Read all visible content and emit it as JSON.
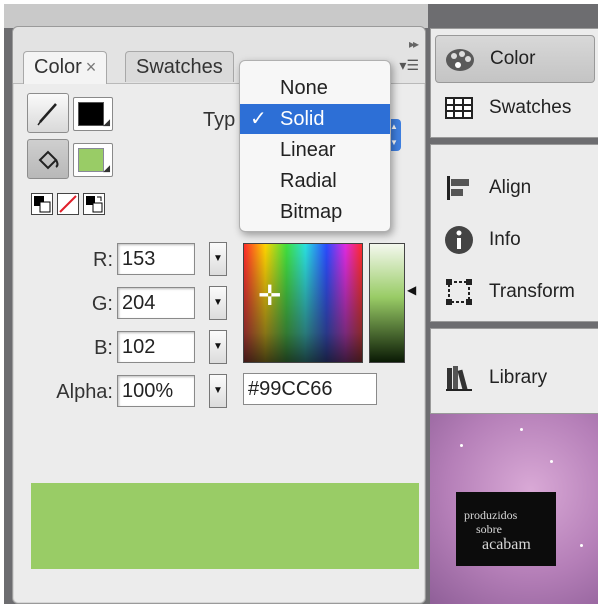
{
  "tabs": [
    {
      "label": "Color",
      "close": "×",
      "active": true
    },
    {
      "label": "Swatches",
      "active": false
    }
  ],
  "type_label": "Typ",
  "fill_types": {
    "options": [
      "None",
      "Solid",
      "Linear",
      "Radial",
      "Bitmap"
    ],
    "selected": "Solid",
    "check": "✓"
  },
  "channels": [
    {
      "label": "R:",
      "value": "153"
    },
    {
      "label": "G:",
      "value": "204"
    },
    {
      "label": "B:",
      "value": "102"
    },
    {
      "label": "Alpha:",
      "value": "100%"
    }
  ],
  "hex": "#99CC66",
  "colors": {
    "fill": "#99cc66",
    "stroke": "#000000",
    "accent": "#2d6fd6"
  },
  "dock": {
    "groups": [
      {
        "items": [
          {
            "label": "Color",
            "icon": "palette-icon",
            "active": true
          },
          {
            "label": "Swatches",
            "icon": "swatches-grid-icon",
            "active": false
          }
        ]
      },
      {
        "items": [
          {
            "label": "Align",
            "icon": "align-icon",
            "active": false
          },
          {
            "label": "Info",
            "icon": "info-icon",
            "active": false
          },
          {
            "label": "Transform",
            "icon": "transform-icon",
            "active": false
          }
        ]
      },
      {
        "items": [
          {
            "label": "Library",
            "icon": "library-icon",
            "active": false
          }
        ]
      }
    ]
  },
  "desktop_thumbnail": {
    "lines": [
      "produzidos",
      "sobre",
      "acabam"
    ]
  }
}
